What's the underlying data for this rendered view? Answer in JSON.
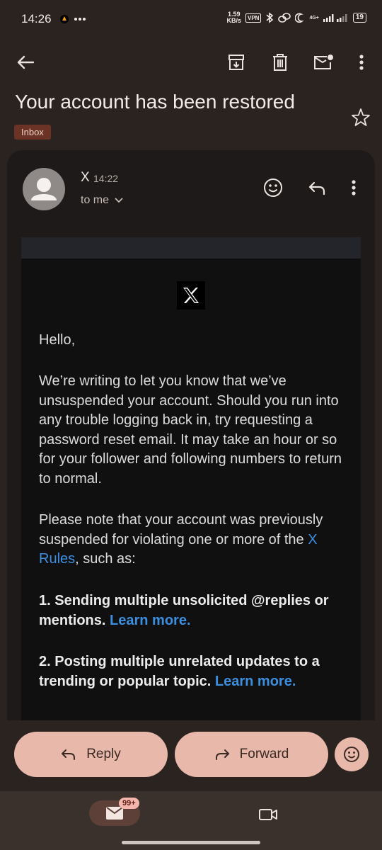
{
  "status_bar": {
    "time": "14:26",
    "speed_top": "1.59",
    "speed_bottom": "KB/s",
    "vpn": "VPN",
    "network": "4G+",
    "battery": "19"
  },
  "toolbar": {
    "back_icon": "arrow-left-icon",
    "archive_icon": "archive-icon",
    "delete_icon": "trash-icon",
    "mark_unread_icon": "mail-unread-icon",
    "more_icon": "more-vert-icon"
  },
  "email": {
    "subject": "Your account has been restored",
    "label": "Inbox",
    "sender": "X",
    "time": "14:22",
    "recipient": "to me",
    "greeting": "Hello,",
    "paragraph1": "We’re writing to let you know that we’ve unsuspended your account. Should you run into any trouble logging back in, try requesting a password reset email. It may take an hour or so for your follower and following numbers to return to normal.",
    "paragraph2_prefix": "Please note that your account was previously suspended for violating one or more of the ",
    "paragraph2_link": "X Rules",
    "paragraph2_suffix": ", such as:",
    "item1_text": "1. Sending multiple unsolicited @replies or mentions. ",
    "item1_link": "Learn more.",
    "item2_text": "2. Posting multiple unrelated updates to a trending or popular topic. ",
    "item2_link": "Learn more."
  },
  "actions": {
    "reply_label": "Reply",
    "forward_label": "Forward"
  },
  "bottom_nav": {
    "mail_badge": "99+"
  },
  "colors": {
    "background": "#2b2320",
    "card": "#1d1a19",
    "accent_button": "#e8b8aa",
    "link": "#3b8fe0",
    "label_chip": "#6a3325"
  }
}
